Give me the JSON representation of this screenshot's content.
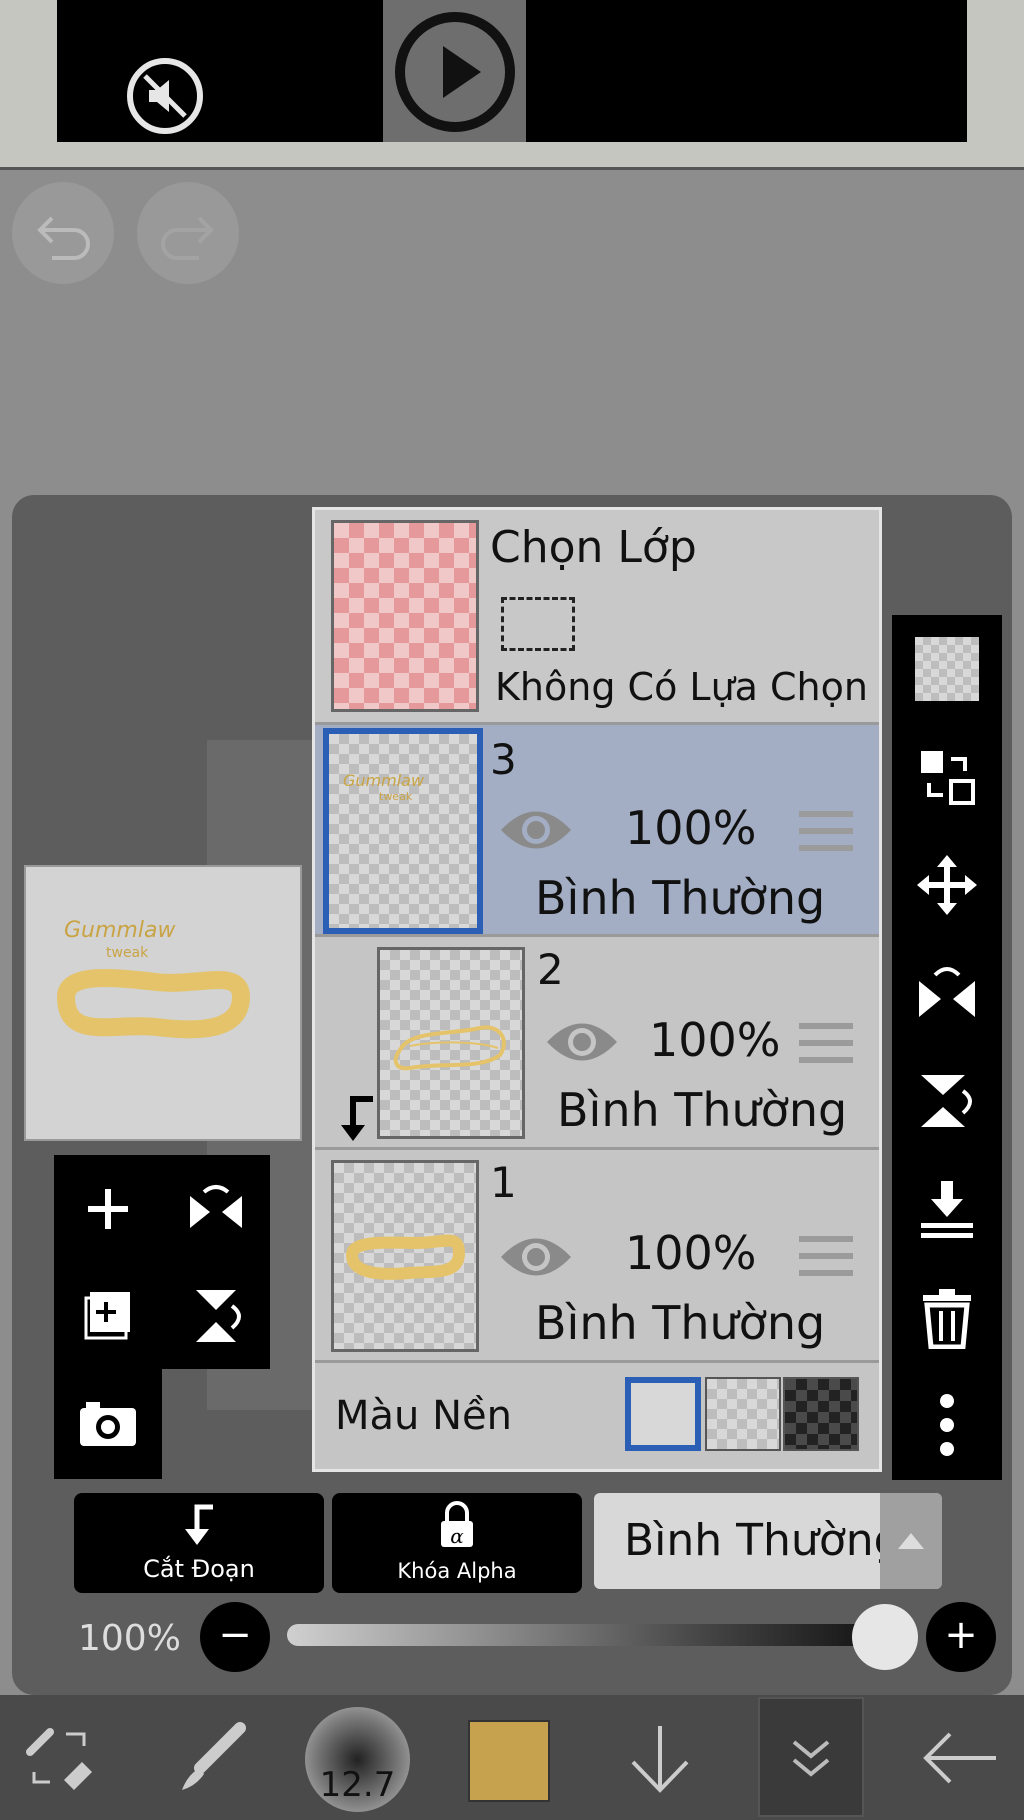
{
  "undo": {
    "undo_icon": "undo-icon",
    "redo_icon": "redo-icon"
  },
  "layers_panel": {
    "selection_layer": {
      "title": "Chọn Lớp",
      "status": "Không Có Lựa Chọn"
    },
    "layers": [
      {
        "number": "3",
        "opacity": "100%",
        "blend": "Bình Thường",
        "selected": true
      },
      {
        "number": "2",
        "opacity": "100%",
        "blend": "Bình Thường",
        "selected": false
      },
      {
        "number": "1",
        "opacity": "100%",
        "blend": "Bình Thường",
        "selected": false
      }
    ],
    "background": {
      "label": "Màu Nền"
    }
  },
  "actions": {
    "clipping": "Cắt Đoạn",
    "alpha_lock": "Khóa Alpha",
    "blend_mode": "Bình Thường"
  },
  "opacity": {
    "label": "100%",
    "value": 1.0
  },
  "toolbar": {
    "brush_size": "12.7",
    "current_color": "#c6a24f"
  },
  "colors": {
    "accent": "#2b5fb5",
    "selected_row": "#a3aec4"
  }
}
